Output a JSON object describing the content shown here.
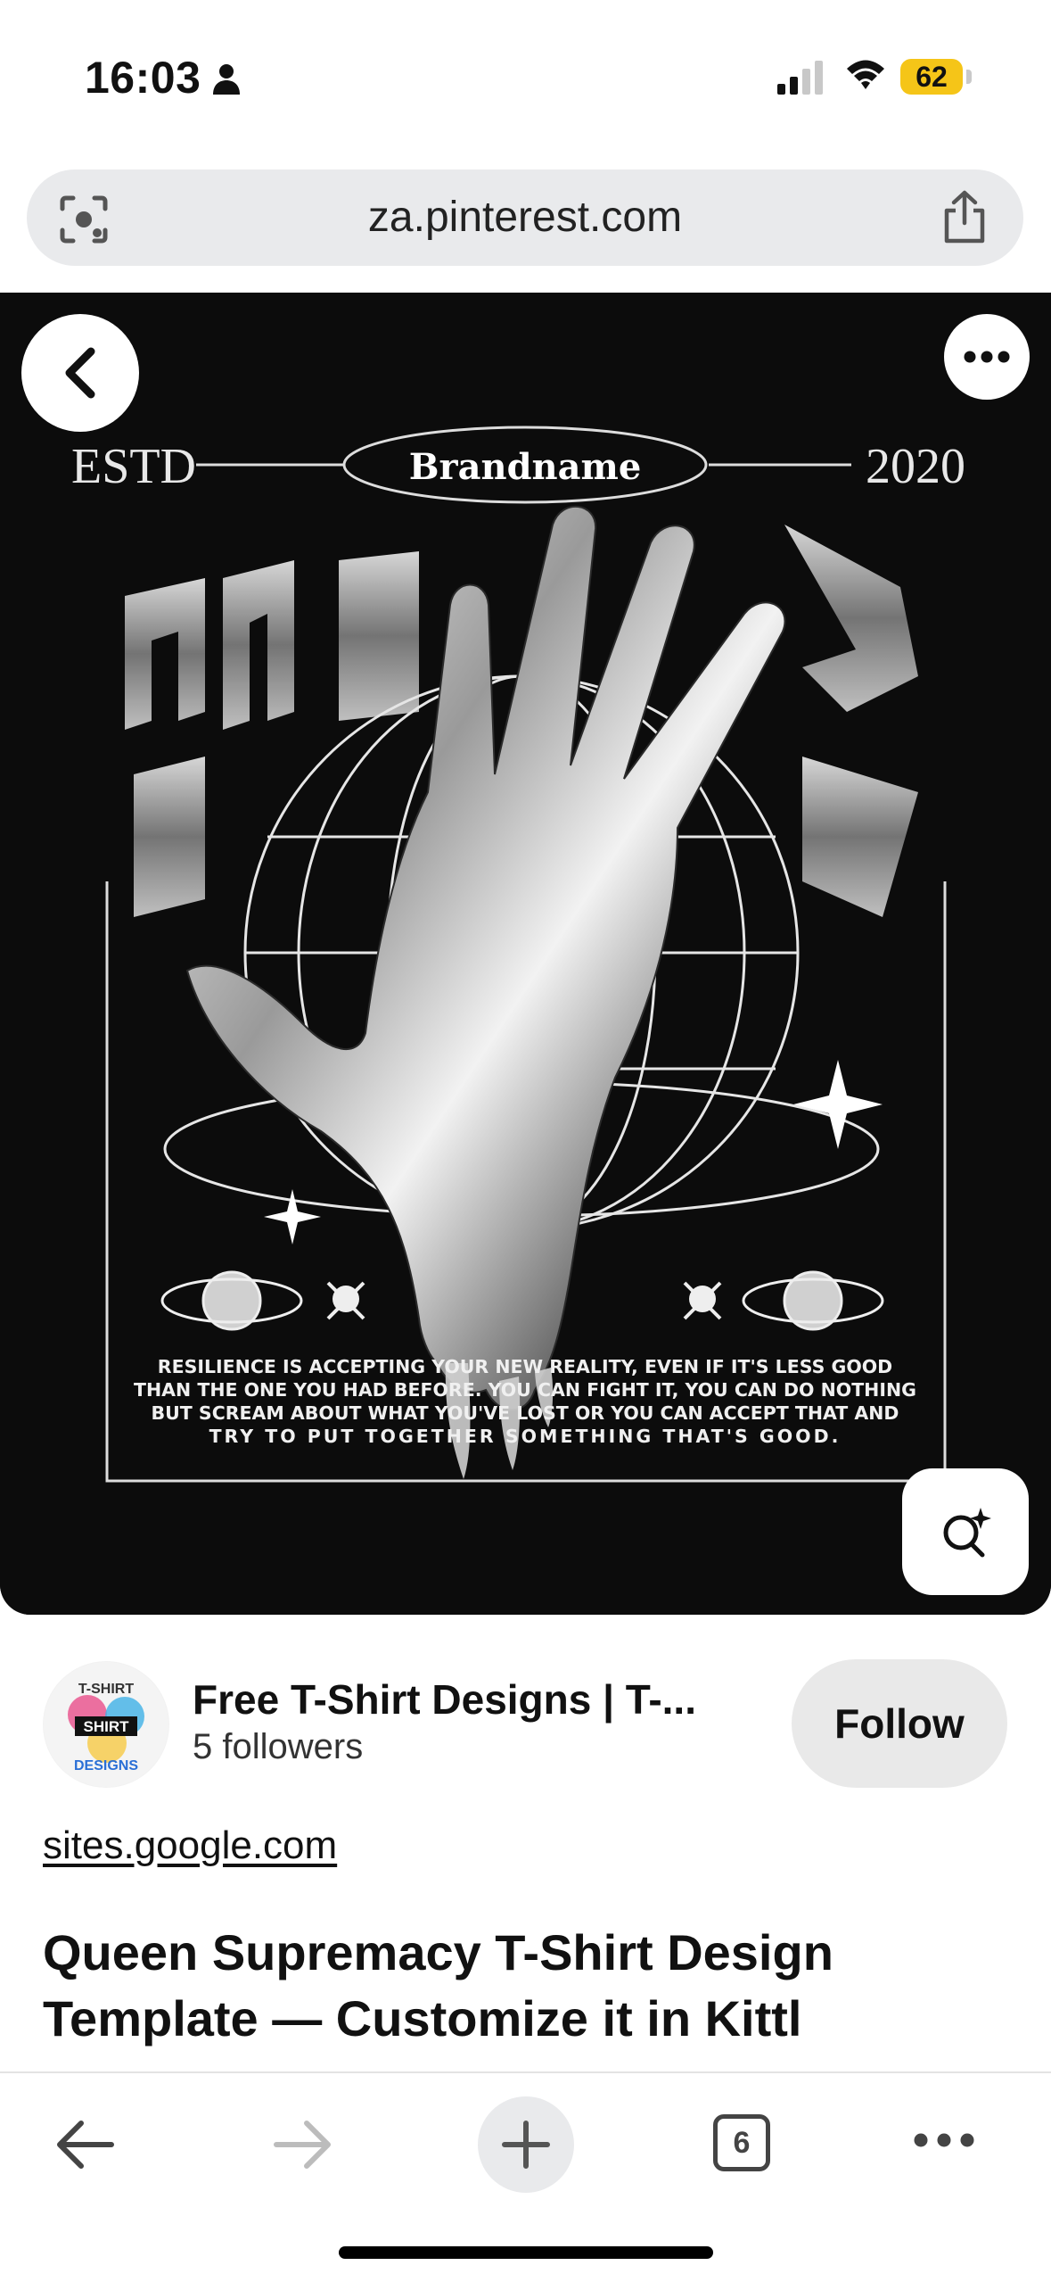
{
  "status_bar": {
    "time": "16:03",
    "battery": "62",
    "battery_color": "#f5c518"
  },
  "browser": {
    "url": "za.pinterest.com"
  },
  "pin": {
    "artwork": {
      "estd": "ESTD",
      "year": "2020",
      "brand": "Brandname",
      "quote_lines": [
        "RESILIENCE IS ACCEPTING YOUR NEW REALITY, EVEN IF IT'S LESS GOOD",
        "THAN THE ONE YOU HAD BEFORE. YOU CAN FIGHT IT, YOU CAN DO NOTHING",
        "BUT SCREAM ABOUT WHAT YOU'VE LOST OR YOU CAN ACCEPT THAT AND",
        "TRY TO PUT TOGETHER SOMETHING THAT'S GOOD."
      ]
    },
    "icons": {
      "back": "chevron-left-icon",
      "more": "ellipsis-icon",
      "visual_search": "lens-sparkle-icon"
    }
  },
  "creator": {
    "name": "Free T-Shirt Designs | T-...",
    "followers": "5 followers",
    "follow_label": "Follow",
    "avatar_text": [
      "T-SHIRT",
      "SHIRT",
      "DESIGNS"
    ]
  },
  "source_link": "sites.google.com",
  "title": "Queen Supremacy T-Shirt Design Template — Customize it in Kittl",
  "toolbar": {
    "tab_count": "6"
  }
}
